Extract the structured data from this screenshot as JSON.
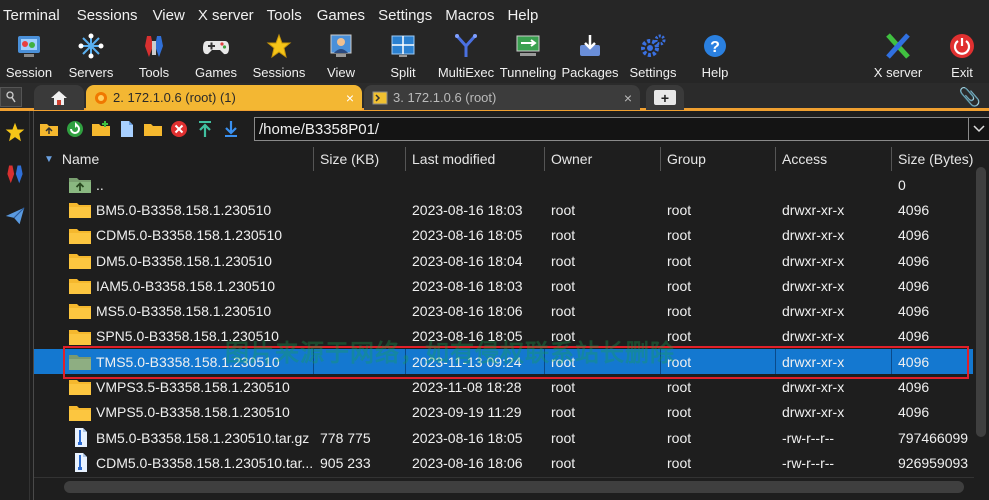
{
  "menubar": [
    "Terminal",
    "Sessions",
    "View",
    "X server",
    "Tools",
    "Games",
    "Settings",
    "Macros",
    "Help"
  ],
  "toolbar": {
    "session": "Session",
    "servers": "Servers",
    "tools": "Tools",
    "games": "Games",
    "sessions": "Sessions",
    "view": "View",
    "split": "Split",
    "multiexec": "MultiExec",
    "tunneling": "Tunneling",
    "packages": "Packages",
    "settings": "Settings",
    "help": "Help",
    "xserver": "X server",
    "exit": "Exit"
  },
  "tabs": {
    "active": "2. 172.1.0.6 (root) (1)",
    "inactive": "3. 172.1.0.6 (root)",
    "close": "×",
    "add": "+"
  },
  "path": "/home/B3358P01/",
  "columns": [
    "Name",
    "Size (KB)",
    "Last modified",
    "Owner",
    "Group",
    "Access",
    "Size (Bytes)"
  ],
  "rows": [
    {
      "name": "..",
      "size": "",
      "modified": "",
      "owner": "",
      "group": "",
      "access": "",
      "bytes": "0",
      "type": "up"
    },
    {
      "name": "BM5.0-B3358.158.1.230510",
      "size": "",
      "modified": "2023-08-16 18:03",
      "owner": "root",
      "group": "root",
      "access": "drwxr-xr-x",
      "bytes": "4096",
      "type": "folder"
    },
    {
      "name": "CDM5.0-B3358.158.1.230510",
      "size": "",
      "modified": "2023-08-16 18:05",
      "owner": "root",
      "group": "root",
      "access": "drwxr-xr-x",
      "bytes": "4096",
      "type": "folder"
    },
    {
      "name": "DM5.0-B3358.158.1.230510",
      "size": "",
      "modified": "2023-08-16 18:04",
      "owner": "root",
      "group": "root",
      "access": "drwxr-xr-x",
      "bytes": "4096",
      "type": "folder"
    },
    {
      "name": "IAM5.0-B3358.158.1.230510",
      "size": "",
      "modified": "2023-08-16 18:03",
      "owner": "root",
      "group": "root",
      "access": "drwxr-xr-x",
      "bytes": "4096",
      "type": "folder"
    },
    {
      "name": "MS5.0-B3358.158.1.230510",
      "size": "",
      "modified": "2023-08-16 18:06",
      "owner": "root",
      "group": "root",
      "access": "drwxr-xr-x",
      "bytes": "4096",
      "type": "folder"
    },
    {
      "name": "SPN5.0-B3358.158.1.230510",
      "size": "",
      "modified": "2023-08-16 18:05",
      "owner": "root",
      "group": "root",
      "access": "drwxr-xr-x",
      "bytes": "4096",
      "type": "folder"
    },
    {
      "name": "TMS5.0-B3358.158.1.230510",
      "size": "",
      "modified": "2023-11-13 09:24",
      "owner": "root",
      "group": "root",
      "access": "drwxr-xr-x",
      "bytes": "4096",
      "type": "folder-selected"
    },
    {
      "name": "VMPS3.5-B3358.158.1.230510",
      "size": "",
      "modified": "2023-11-08 18:28",
      "owner": "root",
      "group": "root",
      "access": "drwxr-xr-x",
      "bytes": "4096",
      "type": "folder"
    },
    {
      "name": "VMPS5.0-B3358.158.1.230510",
      "size": "",
      "modified": "2023-09-19 11:29",
      "owner": "root",
      "group": "root",
      "access": "drwxr-xr-x",
      "bytes": "4096",
      "type": "folder"
    },
    {
      "name": "BM5.0-B3358.158.1.230510.tar.gz",
      "size": "778 775",
      "modified": "2023-08-16 18:05",
      "owner": "root",
      "group": "root",
      "access": "-rw-r--r--",
      "bytes": "797466099",
      "type": "file"
    },
    {
      "name": "CDM5.0-B3358.158.1.230510.tar...",
      "size": "905 233",
      "modified": "2023-08-16 18:06",
      "owner": "root",
      "group": "root",
      "access": "-rw-r--r--",
      "bytes": "926959093",
      "type": "file"
    }
  ],
  "watermark": "图片来源于网络，如有侵权联系站长删除",
  "colors": {
    "accent": "#f3b733",
    "selection": "#1478d0",
    "folder": "#f5b82e",
    "highlight": "#e0202a"
  }
}
